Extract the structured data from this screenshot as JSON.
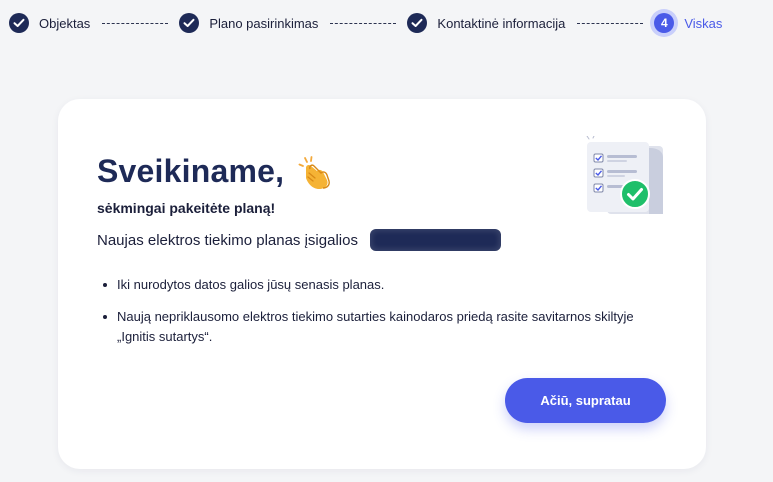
{
  "stepper": {
    "steps": [
      {
        "label": "Objektas",
        "status": "done"
      },
      {
        "label": "Plano pasirinkimas",
        "status": "done"
      },
      {
        "label": "Kontaktinė informacija",
        "status": "done"
      },
      {
        "label": "Viskas",
        "status": "active",
        "number": "4"
      }
    ]
  },
  "card": {
    "title": "Sveikiname,",
    "title_icon": "clapping-hands-icon",
    "subtitle": "sėkmingai pakeitėte planą!",
    "effective_text": "Naujas elektros tiekimo planas įsigalios",
    "bullets": [
      "Iki nurodytos datos galios jūsų senasis planas.",
      "Naują nepriklausomo elektros tiekimo sutarties kainodaros priedą rasite savitarnos skiltyje „Ignitis sutartys“."
    ],
    "illustration_icon": "document-checklist-icon",
    "confirm_label": "Ačiū, supratau"
  },
  "colors": {
    "primary": "#4a5ae8",
    "navy": "#1e2a57",
    "success": "#1fbf6a",
    "background": "#f4f5f7"
  }
}
